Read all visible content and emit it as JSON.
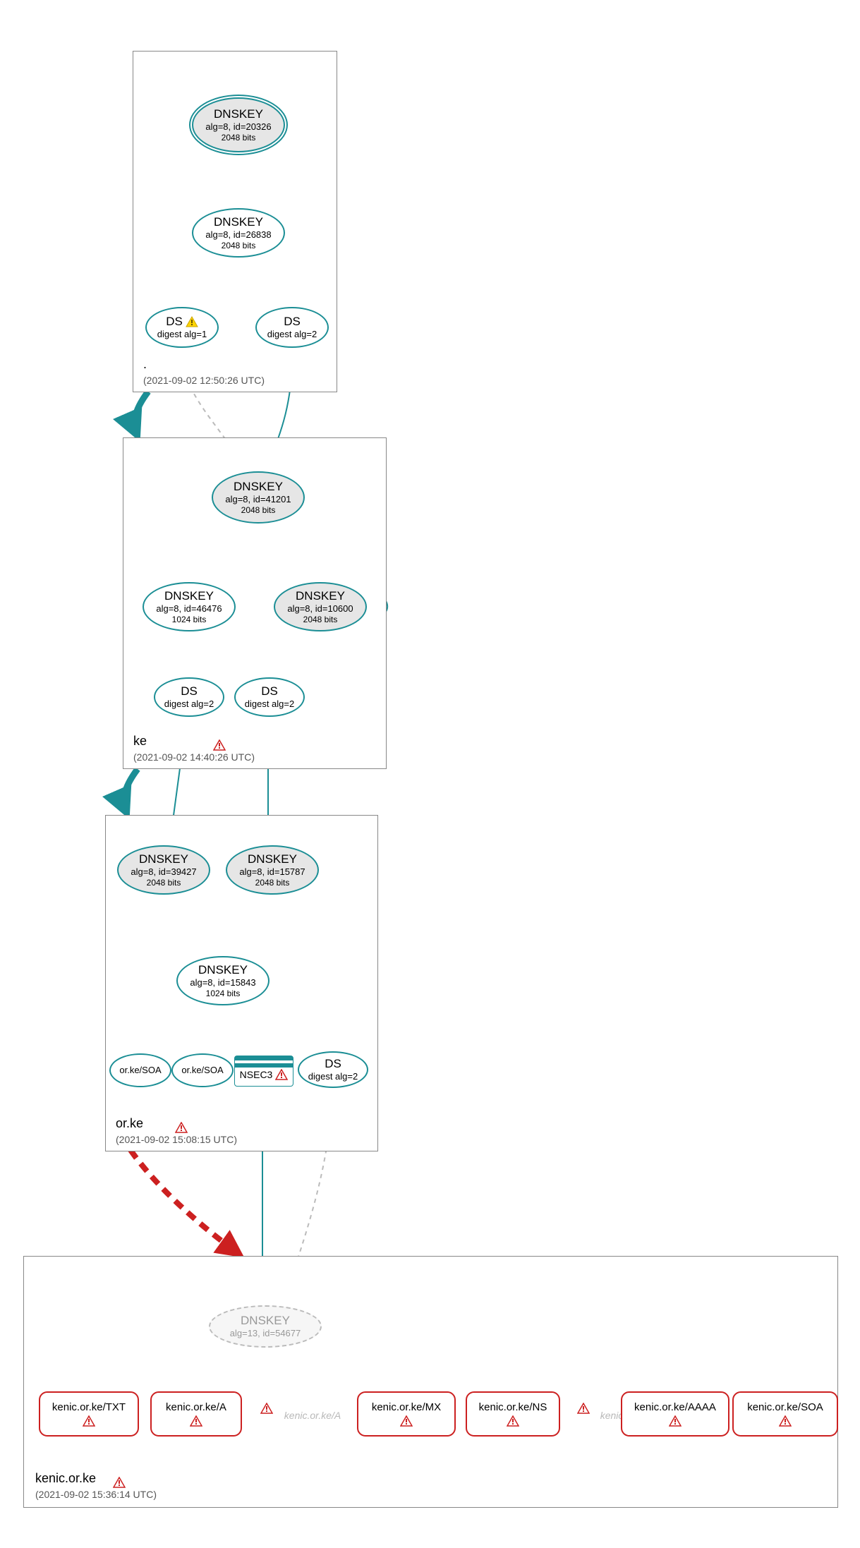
{
  "colors": {
    "teal": "#1b8e95",
    "red": "#cc2020",
    "gray_fill": "#e6e6e6",
    "warn_yellow": "#ffd400",
    "warn_stroke": "#caa600",
    "err_red_fill": "#ffe0e0",
    "err_red_stroke": "#cc2020"
  },
  "zones": {
    "root": {
      "label": ".",
      "timestamp": "(2021-09-02 12:50:26 UTC)"
    },
    "ke": {
      "label": "ke",
      "timestamp": "(2021-09-02 14:40:26 UTC)"
    },
    "orke": {
      "label": "or.ke",
      "timestamp": "(2021-09-02 15:08:15 UTC)"
    },
    "kenic": {
      "label": "kenic.or.ke",
      "timestamp": "(2021-09-02 15:36:14 UTC)"
    }
  },
  "nodes": {
    "root_ksk": {
      "t1": "DNSKEY",
      "t2": "alg=8, id=20326",
      "t3": "2048 bits"
    },
    "root_zsk": {
      "t1": "DNSKEY",
      "t2": "alg=8, id=26838",
      "t3": "2048 bits"
    },
    "root_ds1": {
      "t1": "DS",
      "t2": "digest alg=1"
    },
    "root_ds2": {
      "t1": "DS",
      "t2": "digest alg=2"
    },
    "ke_ksk": {
      "t1": "DNSKEY",
      "t2": "alg=8, id=41201",
      "t3": "2048 bits"
    },
    "ke_zsk": {
      "t1": "DNSKEY",
      "t2": "alg=8, id=46476",
      "t3": "1024 bits"
    },
    "ke_key2": {
      "t1": "DNSKEY",
      "t2": "alg=8, id=10600",
      "t3": "2048 bits"
    },
    "ke_ds1": {
      "t1": "DS",
      "t2": "digest alg=2"
    },
    "ke_ds2": {
      "t1": "DS",
      "t2": "digest alg=2"
    },
    "orke_ksk1": {
      "t1": "DNSKEY",
      "t2": "alg=8, id=39427",
      "t3": "2048 bits"
    },
    "orke_ksk2": {
      "t1": "DNSKEY",
      "t2": "alg=8, id=15787",
      "t3": "2048 bits"
    },
    "orke_zsk": {
      "t1": "DNSKEY",
      "t2": "alg=8, id=15843",
      "t3": "1024 bits"
    },
    "orke_soa1": {
      "t1": "or.ke/SOA"
    },
    "orke_soa2": {
      "t1": "or.ke/SOA"
    },
    "orke_nsec3": {
      "t1": "NSEC3"
    },
    "orke_ds": {
      "t1": "DS",
      "t2": "digest alg=2"
    },
    "kenic_key": {
      "t1": "DNSKEY",
      "t2": "alg=13, id=54677"
    },
    "rr_txt": {
      "label": "kenic.or.ke/TXT"
    },
    "rr_a": {
      "label": "kenic.or.ke/A"
    },
    "rr_mx": {
      "label": "kenic.or.ke/MX"
    },
    "rr_ns": {
      "label": "kenic.or.ke/NS"
    },
    "rr_aaaa": {
      "label": "kenic.or.ke/AAAA"
    },
    "rr_soa": {
      "label": "kenic.or.ke/SOA"
    }
  },
  "faint": {
    "a": "kenic.or.ke/A",
    "ns": "kenic.or.ke/NS"
  },
  "chart_data": {
    "type": "graph",
    "description": "DNSSEC delegation / signature graph from root to kenic.or.ke",
    "zones": [
      {
        "name": ".",
        "timestamp": "2021-09-02 12:50:26 UTC"
      },
      {
        "name": "ke",
        "timestamp": "2021-09-02 14:40:26 UTC",
        "status": "error"
      },
      {
        "name": "or.ke",
        "timestamp": "2021-09-02 15:08:15 UTC",
        "status": "error"
      },
      {
        "name": "kenic.or.ke",
        "timestamp": "2021-09-02 15:36:14 UTC",
        "status": "error"
      }
    ],
    "nodes": [
      {
        "id": "root_ksk",
        "zone": ".",
        "type": "DNSKEY",
        "alg": 8,
        "key_id": 20326,
        "bits": 2048,
        "role": "KSK",
        "sep": true
      },
      {
        "id": "root_zsk",
        "zone": ".",
        "type": "DNSKEY",
        "alg": 8,
        "key_id": 26838,
        "bits": 2048,
        "role": "ZSK"
      },
      {
        "id": "root_ds1",
        "zone": ".",
        "type": "DS",
        "digest_alg": 1,
        "status": "warning"
      },
      {
        "id": "root_ds2",
        "zone": ".",
        "type": "DS",
        "digest_alg": 2
      },
      {
        "id": "ke_ksk",
        "zone": "ke",
        "type": "DNSKEY",
        "alg": 8,
        "key_id": 41201,
        "bits": 2048,
        "role": "KSK"
      },
      {
        "id": "ke_zsk",
        "zone": "ke",
        "type": "DNSKEY",
        "alg": 8,
        "key_id": 46476,
        "bits": 1024,
        "role": "ZSK"
      },
      {
        "id": "ke_key2",
        "zone": "ke",
        "type": "DNSKEY",
        "alg": 8,
        "key_id": 10600,
        "bits": 2048
      },
      {
        "id": "ke_ds1",
        "zone": "ke",
        "type": "DS",
        "digest_alg": 2
      },
      {
        "id": "ke_ds2",
        "zone": "ke",
        "type": "DS",
        "digest_alg": 2
      },
      {
        "id": "orke_ksk1",
        "zone": "or.ke",
        "type": "DNSKEY",
        "alg": 8,
        "key_id": 39427,
        "bits": 2048,
        "role": "KSK"
      },
      {
        "id": "orke_ksk2",
        "zone": "or.ke",
        "type": "DNSKEY",
        "alg": 8,
        "key_id": 15787,
        "bits": 2048,
        "role": "KSK"
      },
      {
        "id": "orke_zsk",
        "zone": "or.ke",
        "type": "DNSKEY",
        "alg": 8,
        "key_id": 15843,
        "bits": 1024,
        "role": "ZSK"
      },
      {
        "id": "orke_soa1",
        "zone": "or.ke",
        "type": "RRset",
        "name": "or.ke/SOA"
      },
      {
        "id": "orke_soa2",
        "zone": "or.ke",
        "type": "RRset",
        "name": "or.ke/SOA"
      },
      {
        "id": "orke_nsec3",
        "zone": "or.ke",
        "type": "NSEC3",
        "status": "error"
      },
      {
        "id": "orke_ds",
        "zone": "or.ke",
        "type": "DS",
        "digest_alg": 2
      },
      {
        "id": "kenic_key",
        "zone": "kenic.or.ke",
        "type": "DNSKEY",
        "alg": 13,
        "key_id": 54677,
        "status": "insecure"
      },
      {
        "id": "rr_txt",
        "zone": "kenic.or.ke",
        "type": "RRset",
        "name": "kenic.or.ke/TXT",
        "status": "error"
      },
      {
        "id": "rr_a",
        "zone": "kenic.or.ke",
        "type": "RRset",
        "name": "kenic.or.ke/A",
        "status": "error"
      },
      {
        "id": "rr_mx",
        "zone": "kenic.or.ke",
        "type": "RRset",
        "name": "kenic.or.ke/MX",
        "status": "error"
      },
      {
        "id": "rr_ns",
        "zone": "kenic.or.ke",
        "type": "RRset",
        "name": "kenic.or.ke/NS",
        "status": "error"
      },
      {
        "id": "rr_aaaa",
        "zone": "kenic.or.ke",
        "type": "RRset",
        "name": "kenic.or.ke/AAAA",
        "status": "error"
      },
      {
        "id": "rr_soa",
        "zone": "kenic.or.ke",
        "type": "RRset",
        "name": "kenic.or.ke/SOA",
        "status": "error"
      }
    ],
    "edges": [
      {
        "from": "root_ksk",
        "to": "root_ksk",
        "kind": "self-sig",
        "style": "solid",
        "color": "teal"
      },
      {
        "from": "root_ksk",
        "to": "root_zsk",
        "style": "solid",
        "color": "teal"
      },
      {
        "from": "root_zsk",
        "to": "root_ds1",
        "style": "solid",
        "color": "teal"
      },
      {
        "from": "root_zsk",
        "to": "root_ds2",
        "style": "solid",
        "color": "teal"
      },
      {
        "from": "root_ds1",
        "to": "ke_ksk",
        "style": "dashed",
        "color": "gray"
      },
      {
        "from": "root_ds2",
        "to": "ke_ksk",
        "style": "solid",
        "color": "teal"
      },
      {
        "from": "ke_ksk",
        "to": "ke_ksk",
        "kind": "self-sig",
        "style": "solid",
        "color": "teal"
      },
      {
        "from": "ke_ksk",
        "to": "ke_zsk",
        "style": "solid",
        "color": "teal"
      },
      {
        "from": "ke_ksk",
        "to": "ke_key2",
        "style": "solid",
        "color": "teal"
      },
      {
        "from": "ke_key2",
        "to": "ke_key2",
        "kind": "self-sig",
        "style": "solid",
        "color": "teal"
      },
      {
        "from": "ke_zsk",
        "to": "ke_ds1",
        "style": "solid",
        "color": "teal"
      },
      {
        "from": "ke_zsk",
        "to": "ke_ds2",
        "style": "solid",
        "color": "teal"
      },
      {
        "from": "ke_ds1",
        "to": "orke_ksk1",
        "style": "solid",
        "color": "teal"
      },
      {
        "from": "ke_ds2",
        "to": "orke_ksk2",
        "style": "solid",
        "color": "teal"
      },
      {
        "from": "orke_ksk1",
        "to": "orke_ksk1",
        "kind": "self-sig",
        "style": "solid",
        "color": "teal"
      },
      {
        "from": "orke_ksk2",
        "to": "orke_ksk2",
        "kind": "self-sig",
        "style": "solid",
        "color": "teal"
      },
      {
        "from": "orke_ksk1",
        "to": "orke_zsk",
        "style": "solid",
        "color": "teal"
      },
      {
        "from": "orke_ksk2",
        "to": "orke_zsk",
        "style": "solid",
        "color": "teal"
      },
      {
        "from": "orke_zsk",
        "to": "orke_soa1",
        "style": "solid",
        "color": "teal"
      },
      {
        "from": "orke_zsk",
        "to": "orke_soa2",
        "style": "solid",
        "color": "teal"
      },
      {
        "from": "orke_zsk",
        "to": "orke_nsec3",
        "style": "solid",
        "color": "teal"
      },
      {
        "from": "orke_zsk",
        "to": "orke_ds",
        "style": "solid",
        "color": "teal"
      },
      {
        "from": "orke_ds",
        "to": "kenic_key",
        "style": "dashed",
        "color": "gray"
      },
      {
        "from": "orke_nsec3",
        "to": "kenic_key",
        "style": "solid",
        "color": "teal"
      },
      {
        "from": "zone:.",
        "to": "zone:ke",
        "kind": "delegation",
        "color": "teal",
        "thick": true
      },
      {
        "from": "zone:ke",
        "to": "zone:or.ke",
        "kind": "delegation",
        "color": "teal",
        "thick": true
      },
      {
        "from": "zone:or.ke",
        "to": "zone:kenic.or.ke",
        "kind": "delegation",
        "color": "red",
        "style": "dashed",
        "thick": true
      }
    ],
    "annotations": [
      {
        "near": "root_ds1",
        "icon": "warning"
      },
      {
        "near": "ke zone label",
        "icon": "error"
      },
      {
        "near": "or.ke zone label",
        "icon": "error"
      },
      {
        "near": "orke_nsec3",
        "icon": "error"
      },
      {
        "near": "kenic.or.ke zone label",
        "icon": "error"
      },
      {
        "near": "faint kenic.or.ke/A",
        "icon": "error"
      },
      {
        "near": "faint kenic.or.ke/NS",
        "icon": "error"
      }
    ]
  }
}
